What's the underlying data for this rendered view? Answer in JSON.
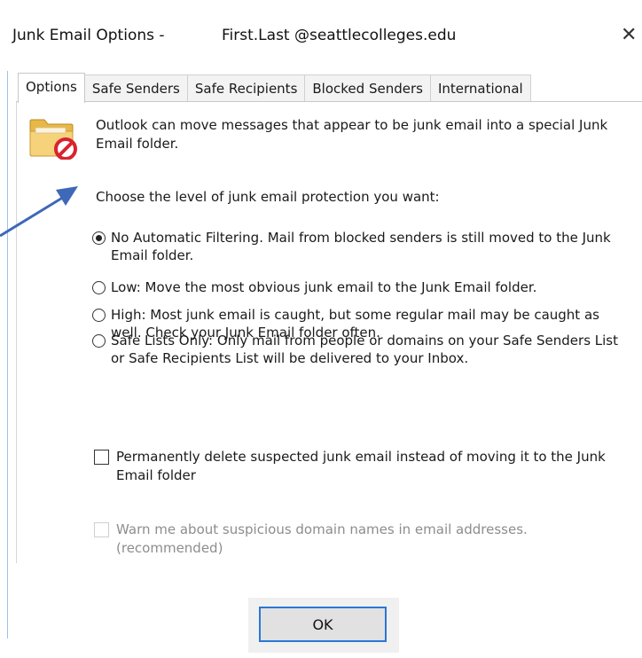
{
  "window": {
    "title": "Junk Email Options -",
    "account": "First.Last @seattlecolleges.edu",
    "close_glyph": "✕"
  },
  "tabs": [
    {
      "label": "Options",
      "active": true
    },
    {
      "label": "Safe Senders",
      "active": false
    },
    {
      "label": "Safe Recipients",
      "active": false
    },
    {
      "label": "Blocked Senders",
      "active": false
    },
    {
      "label": "International",
      "active": false
    }
  ],
  "options": {
    "intro": "Outlook can move messages that appear to be junk email into a special Junk Email folder.",
    "prompt": "Choose the level of junk email protection you want:",
    "levels": [
      {
        "label": "No Automatic Filtering. Mail from blocked senders is still moved to the Junk Email folder.",
        "selected": true
      },
      {
        "label": "Low: Move the most obvious junk email to the Junk Email folder.",
        "selected": false
      },
      {
        "label": "High: Most junk email is caught, but some regular mail may be caught as well. Check your Junk Email folder often.",
        "selected": false
      },
      {
        "label": "Safe Lists Only: Only mail from people or domains on your Safe Senders List or Safe Recipients List will be delivered to your Inbox.",
        "selected": false
      }
    ],
    "permanently_delete": {
      "label": "Permanently delete suspected junk email instead of moving it to the Junk Email folder",
      "checked": false
    },
    "warn_suspicious": {
      "label": "Warn me about suspicious domain names in email addresses. (recommended)",
      "checked": false,
      "disabled": true
    }
  },
  "buttons": {
    "ok": "OK"
  },
  "icons": {
    "folder": "junk-folder-icon",
    "block_badge": "no-entry-icon"
  },
  "colors": {
    "accent": "#2a77d6",
    "arrow": "#3e68b8",
    "block_red": "#d9232e",
    "folder_yellow": "#f2c75c"
  }
}
